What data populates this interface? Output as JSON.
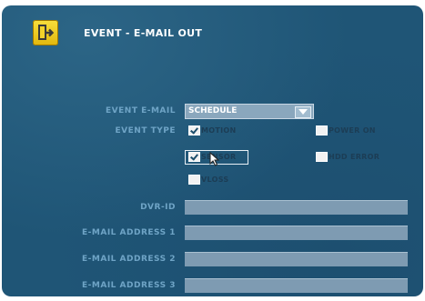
{
  "header": {
    "title": "EVENT - E-MAIL OUT",
    "icon": "exit-door-icon"
  },
  "event_email": {
    "label": "EVENT E-MAIL",
    "value": "SCHEDULE"
  },
  "event_type": {
    "label": "EVENT TYPE",
    "options": [
      {
        "label": "MOTION",
        "checked": true
      },
      {
        "label": "POWER ON",
        "checked": false
      },
      {
        "label": "SENSOR",
        "checked": true
      },
      {
        "label": "HDD ERROR",
        "checked": false
      },
      {
        "label": "VLOSS",
        "checked": false
      }
    ]
  },
  "fields": [
    {
      "label": "DVR-ID",
      "value": ""
    },
    {
      "label": "E-MAIL ADDRESS 1",
      "value": ""
    },
    {
      "label": "E-MAIL ADDRESS 2",
      "value": ""
    },
    {
      "label": "E-MAIL ADDRESS 3",
      "value": ""
    }
  ],
  "colors": {
    "background": "#1f5576",
    "label": "#6fa4c6",
    "field": "#7e9bb2",
    "icon": "#f2c81e"
  }
}
